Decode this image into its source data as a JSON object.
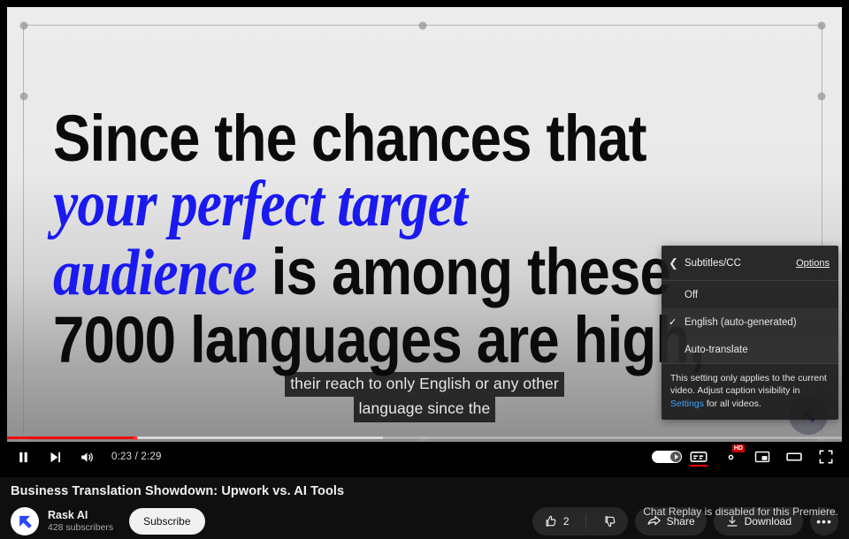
{
  "video": {
    "headline_lines": [
      {
        "id": "l1",
        "text": "Since the chances that",
        "accent": false
      },
      {
        "id": "l2",
        "text": "your perfect target",
        "accent": true
      },
      {
        "id": "l3a",
        "text": "audience",
        "accent": true,
        "suffix": " is among these"
      },
      {
        "id": "l4",
        "text": "7000 languages are high,",
        "accent": false
      }
    ],
    "line1": "Since the chances that",
    "line2": "your perfect target",
    "line3_accent": "audience",
    "line3_rest": " is among these",
    "line4": "7000 languages are high,",
    "watermark_icon": "rask-arrow-icon"
  },
  "captions": {
    "line1": "their reach to only English or any other",
    "line2": "language since the"
  },
  "cc_menu": {
    "back_icon": "chevron-left-icon",
    "title": "Subtitles/CC",
    "options_link": "Options",
    "items": [
      {
        "label": "Off",
        "selected": false
      },
      {
        "label": "English (auto-generated)",
        "selected": true
      },
      {
        "label": "Auto-translate",
        "selected": false
      }
    ],
    "item_off": "Off",
    "item_english": "English (auto-generated)",
    "item_autotranslate": "Auto-translate",
    "note_part1": "This setting only applies to the current video. Adjust caption visibility in ",
    "note_link": "Settings",
    "note_part2": " for all videos.",
    "check_glyph": "✓"
  },
  "player_controls": {
    "play_pause": "pause-button",
    "next": "next-video-button",
    "volume": "volume-button",
    "time_current": "0:23",
    "time_separator": " / ",
    "time_total": "2:29",
    "time_display": "0:23 / 2:29",
    "progress_percent": 15.4,
    "autoplay_label": "autoplay-toggle",
    "autoplay_on": true,
    "captions_label": "CC",
    "captions_active": true,
    "settings_label": "settings-gear",
    "quality_badge": "HD",
    "miniplayer_label": "miniplayer-button",
    "theater_label": "theater-mode-button",
    "fullscreen_label": "fullscreen-button"
  },
  "below_player": {
    "title": "Business Translation Showdown: Upwork vs. AI Tools",
    "channel_name": "Rask AI",
    "subscriber_count": "428 subscribers",
    "subscribe_label": "Subscribe",
    "like_count": "2",
    "share_label": "Share",
    "download_label": "Download",
    "more_label": "•••",
    "chat_note": "Chat Replay is disabled for this Premiere."
  },
  "colors": {
    "brand_red": "#ff0000",
    "accent_blue": "#1a1af0",
    "link_blue": "#3ea6ff",
    "page_bg": "#0f0f0f",
    "pill_bg": "#272727",
    "hd_badge": "#cc0000"
  }
}
